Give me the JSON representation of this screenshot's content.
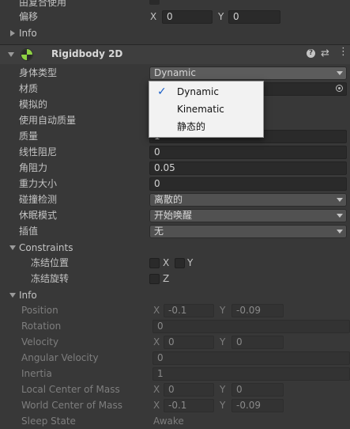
{
  "top": {
    "used_by_composite": "由复合使用",
    "offset_label": "偏移",
    "offset_x_label": "X",
    "offset_x": "0",
    "offset_y_label": "Y",
    "offset_y": "0",
    "info_label": "Info"
  },
  "component": {
    "title": "Rigidbody 2D",
    "icons": [
      "help-icon",
      "settings-icon",
      "more-icon"
    ]
  },
  "rows": {
    "body_type_label": "身体类型",
    "body_type_value": "Dynamic",
    "material_label": "材质",
    "simulated_label": "模拟的",
    "auto_mass_label": "使用自动质量",
    "mass_label": "质量",
    "mass_value": "1",
    "linear_drag_label": "线性阻尼",
    "linear_drag_value": "0",
    "angular_drag_label": "角阻力",
    "angular_drag_value": "0.05",
    "gravity_label": "重力大小",
    "gravity_value": "0",
    "collision_label": "碰撞检测",
    "collision_value": "离散的",
    "sleep_label": "休眠模式",
    "sleep_value": "开始唤醒",
    "interp_label": "插值",
    "interp_value": "无"
  },
  "constraints": {
    "header": "Constraints",
    "freeze_pos_label": "冻结位置",
    "freeze_pos_x": "X",
    "freeze_pos_y": "Y",
    "freeze_rot_label": "冻结旋转",
    "freeze_rot_z": "Z"
  },
  "info": {
    "header": "Info",
    "position_label": "Position",
    "position_x_label": "X",
    "position_x": "-0.1",
    "position_y_label": "Y",
    "position_y": "-0.09",
    "rotation_label": "Rotation",
    "rotation_value": "0",
    "velocity_label": "Velocity",
    "velocity_x_label": "X",
    "velocity_x": "0",
    "velocity_y_label": "Y",
    "velocity_y": "0",
    "angular_velocity_label": "Angular Velocity",
    "angular_velocity_value": "0",
    "inertia_label": "Inertia",
    "inertia_value": "1",
    "local_com_label": "Local Center of Mass",
    "local_com_x_label": "X",
    "local_com_x": "0",
    "local_com_y_label": "Y",
    "local_com_y": "0",
    "world_com_label": "World Center of Mass",
    "world_com_x_label": "X",
    "world_com_x": "-0.1",
    "world_com_y_label": "Y",
    "world_com_y": "-0.09",
    "sleep_state_label": "Sleep State",
    "sleep_state_value": "Awake"
  },
  "dropdown_menu": {
    "options": [
      "Dynamic",
      "Kinematic",
      "静态的"
    ],
    "selected": "Dynamic"
  }
}
